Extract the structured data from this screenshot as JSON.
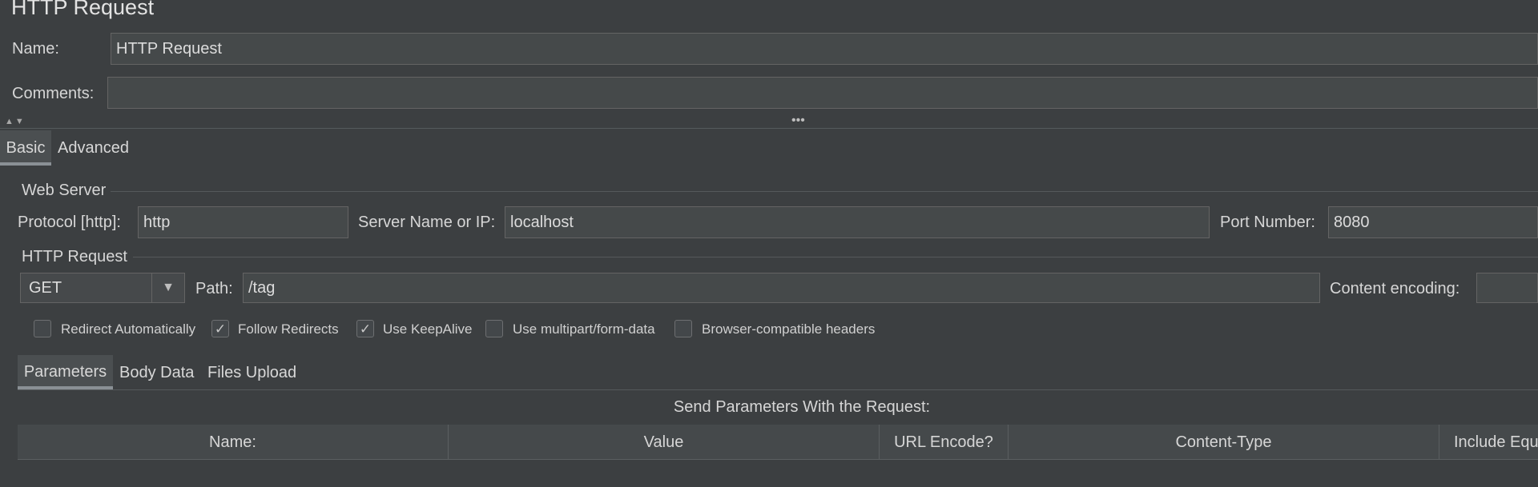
{
  "panel": {
    "title": "HTTP Request"
  },
  "name_field": {
    "label": "Name:",
    "value": "HTTP Request"
  },
  "comments_field": {
    "label": "Comments:",
    "value": ""
  },
  "splitter": {
    "arrows": "▲▼",
    "handle": "•••"
  },
  "main_tabs": [
    {
      "label": "Basic",
      "active": true
    },
    {
      "label": "Advanced",
      "active": false
    }
  ],
  "web_server": {
    "title": "Web Server",
    "protocol_label": "Protocol [http]:",
    "protocol_value": "http",
    "server_label": "Server Name or IP:",
    "server_value": "localhost",
    "port_label": "Port Number:",
    "port_value": "8080"
  },
  "http_request": {
    "title": "HTTP Request",
    "method": "GET",
    "method_dropdown_icon": "chevron-down-icon",
    "path_label": "Path:",
    "path_value": "/tag",
    "encoding_label": "Content encoding:",
    "encoding_value": ""
  },
  "options": [
    {
      "label": "Redirect Automatically",
      "checked": false
    },
    {
      "label": "Follow Redirects",
      "checked": true
    },
    {
      "label": "Use KeepAlive",
      "checked": true
    },
    {
      "label": "Use multipart/form-data",
      "checked": false
    },
    {
      "label": "Browser-compatible headers",
      "checked": false
    }
  ],
  "sub_tabs": [
    {
      "label": "Parameters",
      "active": true
    },
    {
      "label": "Body Data",
      "active": false
    },
    {
      "label": "Files Upload",
      "active": false
    }
  ],
  "parameters_table": {
    "caption": "Send Parameters With the Request:",
    "columns": [
      "Name:",
      "Value",
      "URL Encode?",
      "Content-Type",
      "Include Equ"
    ]
  },
  "colors": {
    "background": "#3c3f41",
    "field": "#45494a",
    "border": "#646464",
    "text": "#d4d4d4"
  }
}
